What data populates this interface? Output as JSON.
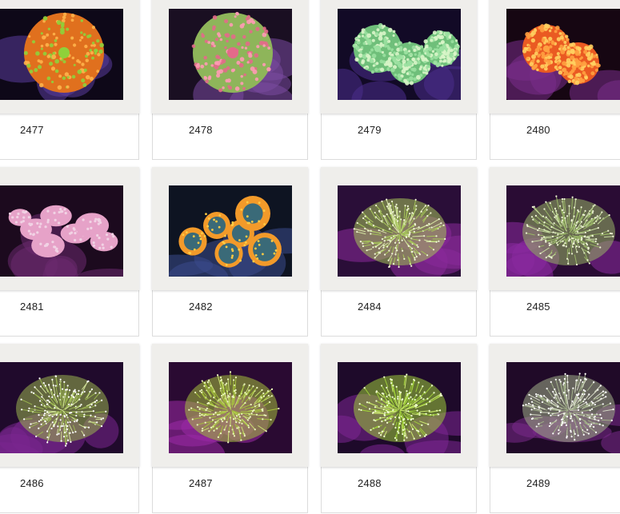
{
  "gallery": {
    "items": [
      {
        "label": "2477",
        "bg": "#0e0818",
        "rock": "#5a3d9c",
        "body": "#e0701e",
        "accent": "#8fd13a",
        "tip": "#ffb24a",
        "style": "disc"
      },
      {
        "label": "2478",
        "bg": "#1a0f22",
        "rock": "#7a4aa0",
        "body": "#8eb55a",
        "accent": "#e36a8a",
        "tip": "#ff9ab4",
        "style": "disc"
      },
      {
        "label": "2479",
        "bg": "#120a26",
        "rock": "#4a2e8c",
        "body": "#6fbf7a",
        "accent": "#9ae0a0",
        "tip": "#d9f5c9",
        "style": "disc"
      },
      {
        "label": "2480",
        "bg": "#160612",
        "rock": "#7a2e8a",
        "body": "#ea5a22",
        "accent": "#ffa040",
        "tip": "#ffd060",
        "style": "disc"
      },
      {
        "label": "2481",
        "bg": "#1c0a1e",
        "rock": "#6c2a70",
        "body": "#e6a2c8",
        "accent": "#f1d2e4",
        "tip": "#ffffff",
        "style": "blob"
      },
      {
        "label": "2482",
        "bg": "#0e1422",
        "rock": "#3a4a8c",
        "body": "#3a6a78",
        "accent": "#f29a2a",
        "tip": "#ffcc44",
        "style": "cluster"
      },
      {
        "label": "2484",
        "bg": "#2a0e38",
        "rock": "#8a2a9a",
        "body": "#a6c45a",
        "accent": "#d6e6a4",
        "tip": "#f1f5d8",
        "style": "tentacle"
      },
      {
        "label": "2485",
        "bg": "#2a0c34",
        "rock": "#8a2aa0",
        "body": "#98b466",
        "accent": "#c8dca0",
        "tip": "#eef4d6",
        "style": "tentacle"
      },
      {
        "label": "2486",
        "bg": "#200a2c",
        "rock": "#7a2690",
        "body": "#9ab450",
        "accent": "#d0e098",
        "tip": "#ffffff",
        "style": "tentacle"
      },
      {
        "label": "2487",
        "bg": "#2a0a32",
        "rock": "#9a2aa6",
        "body": "#a4c03c",
        "accent": "#c8e070",
        "tip": "#eef8c0",
        "style": "tentacle"
      },
      {
        "label": "2488",
        "bg": "#1e0a2a",
        "rock": "#7e2694",
        "body": "#9ecc3a",
        "accent": "#cbe870",
        "tip": "#f0ffd0",
        "style": "tentacle"
      },
      {
        "label": "2489",
        "bg": "#200a28",
        "rock": "#7a2a8a",
        "body": "#a0ae88",
        "accent": "#d8dcc8",
        "tip": "#ffffff",
        "style": "tentacle"
      }
    ]
  }
}
